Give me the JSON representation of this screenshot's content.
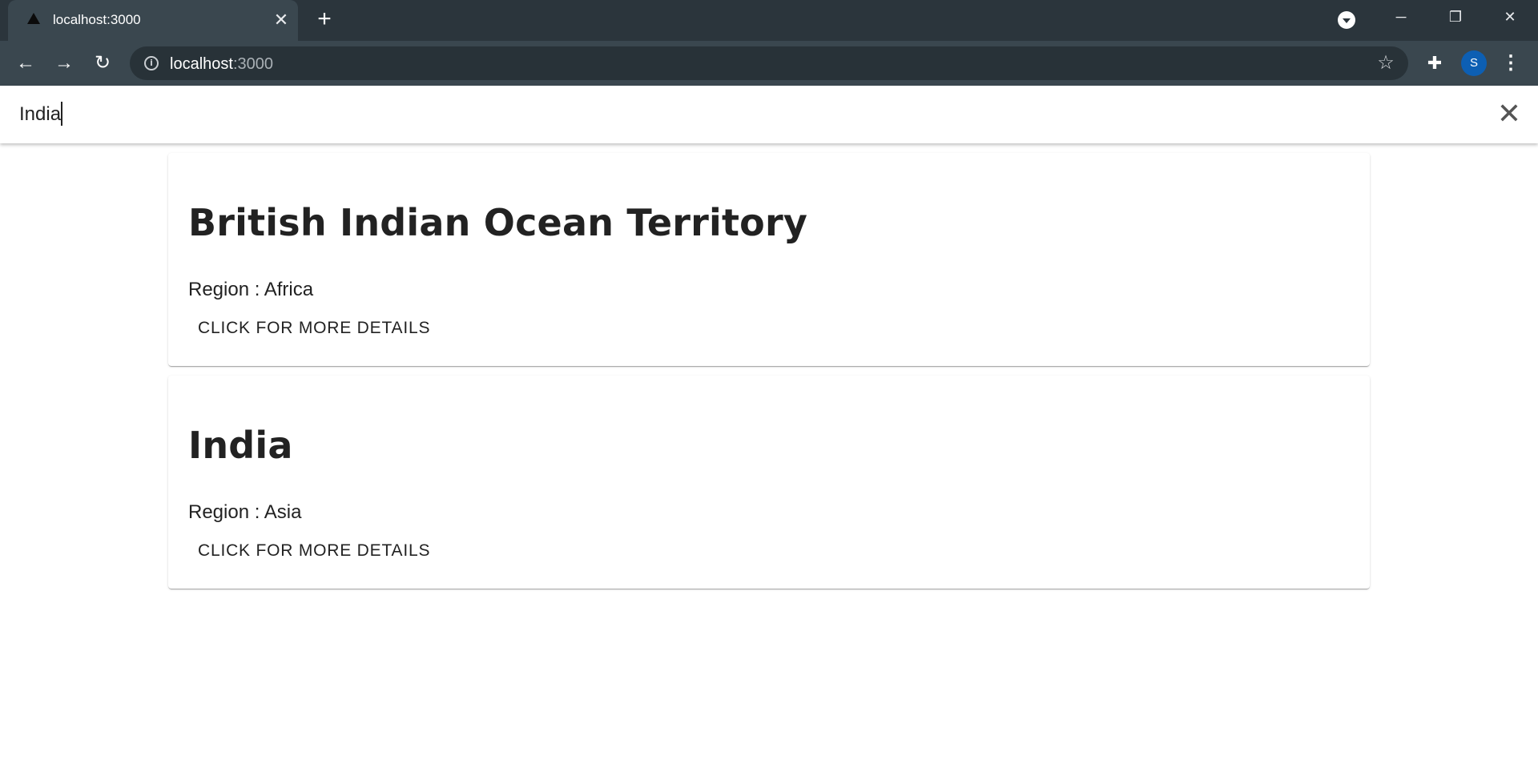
{
  "browser": {
    "tab": {
      "title": "localhost:3000",
      "favicon": "triangle-icon"
    },
    "url": {
      "host": "localhost",
      "port": ":3000"
    },
    "profile_initial": "S"
  },
  "search": {
    "value": "India",
    "clear_icon": "close-icon"
  },
  "results": [
    {
      "name": "British Indian Ocean Territory",
      "region": "Region : Africa",
      "button_label": "CLICK FOR MORE DETAILS"
    },
    {
      "name": "India",
      "region": "Region : Asia",
      "button_label": "CLICK FOR MORE DETAILS"
    }
  ],
  "colors": {
    "tabstrip": "#2b353c",
    "toolbar": "#3a474f",
    "avatar": "#0d5fb3",
    "text": "#222222"
  }
}
